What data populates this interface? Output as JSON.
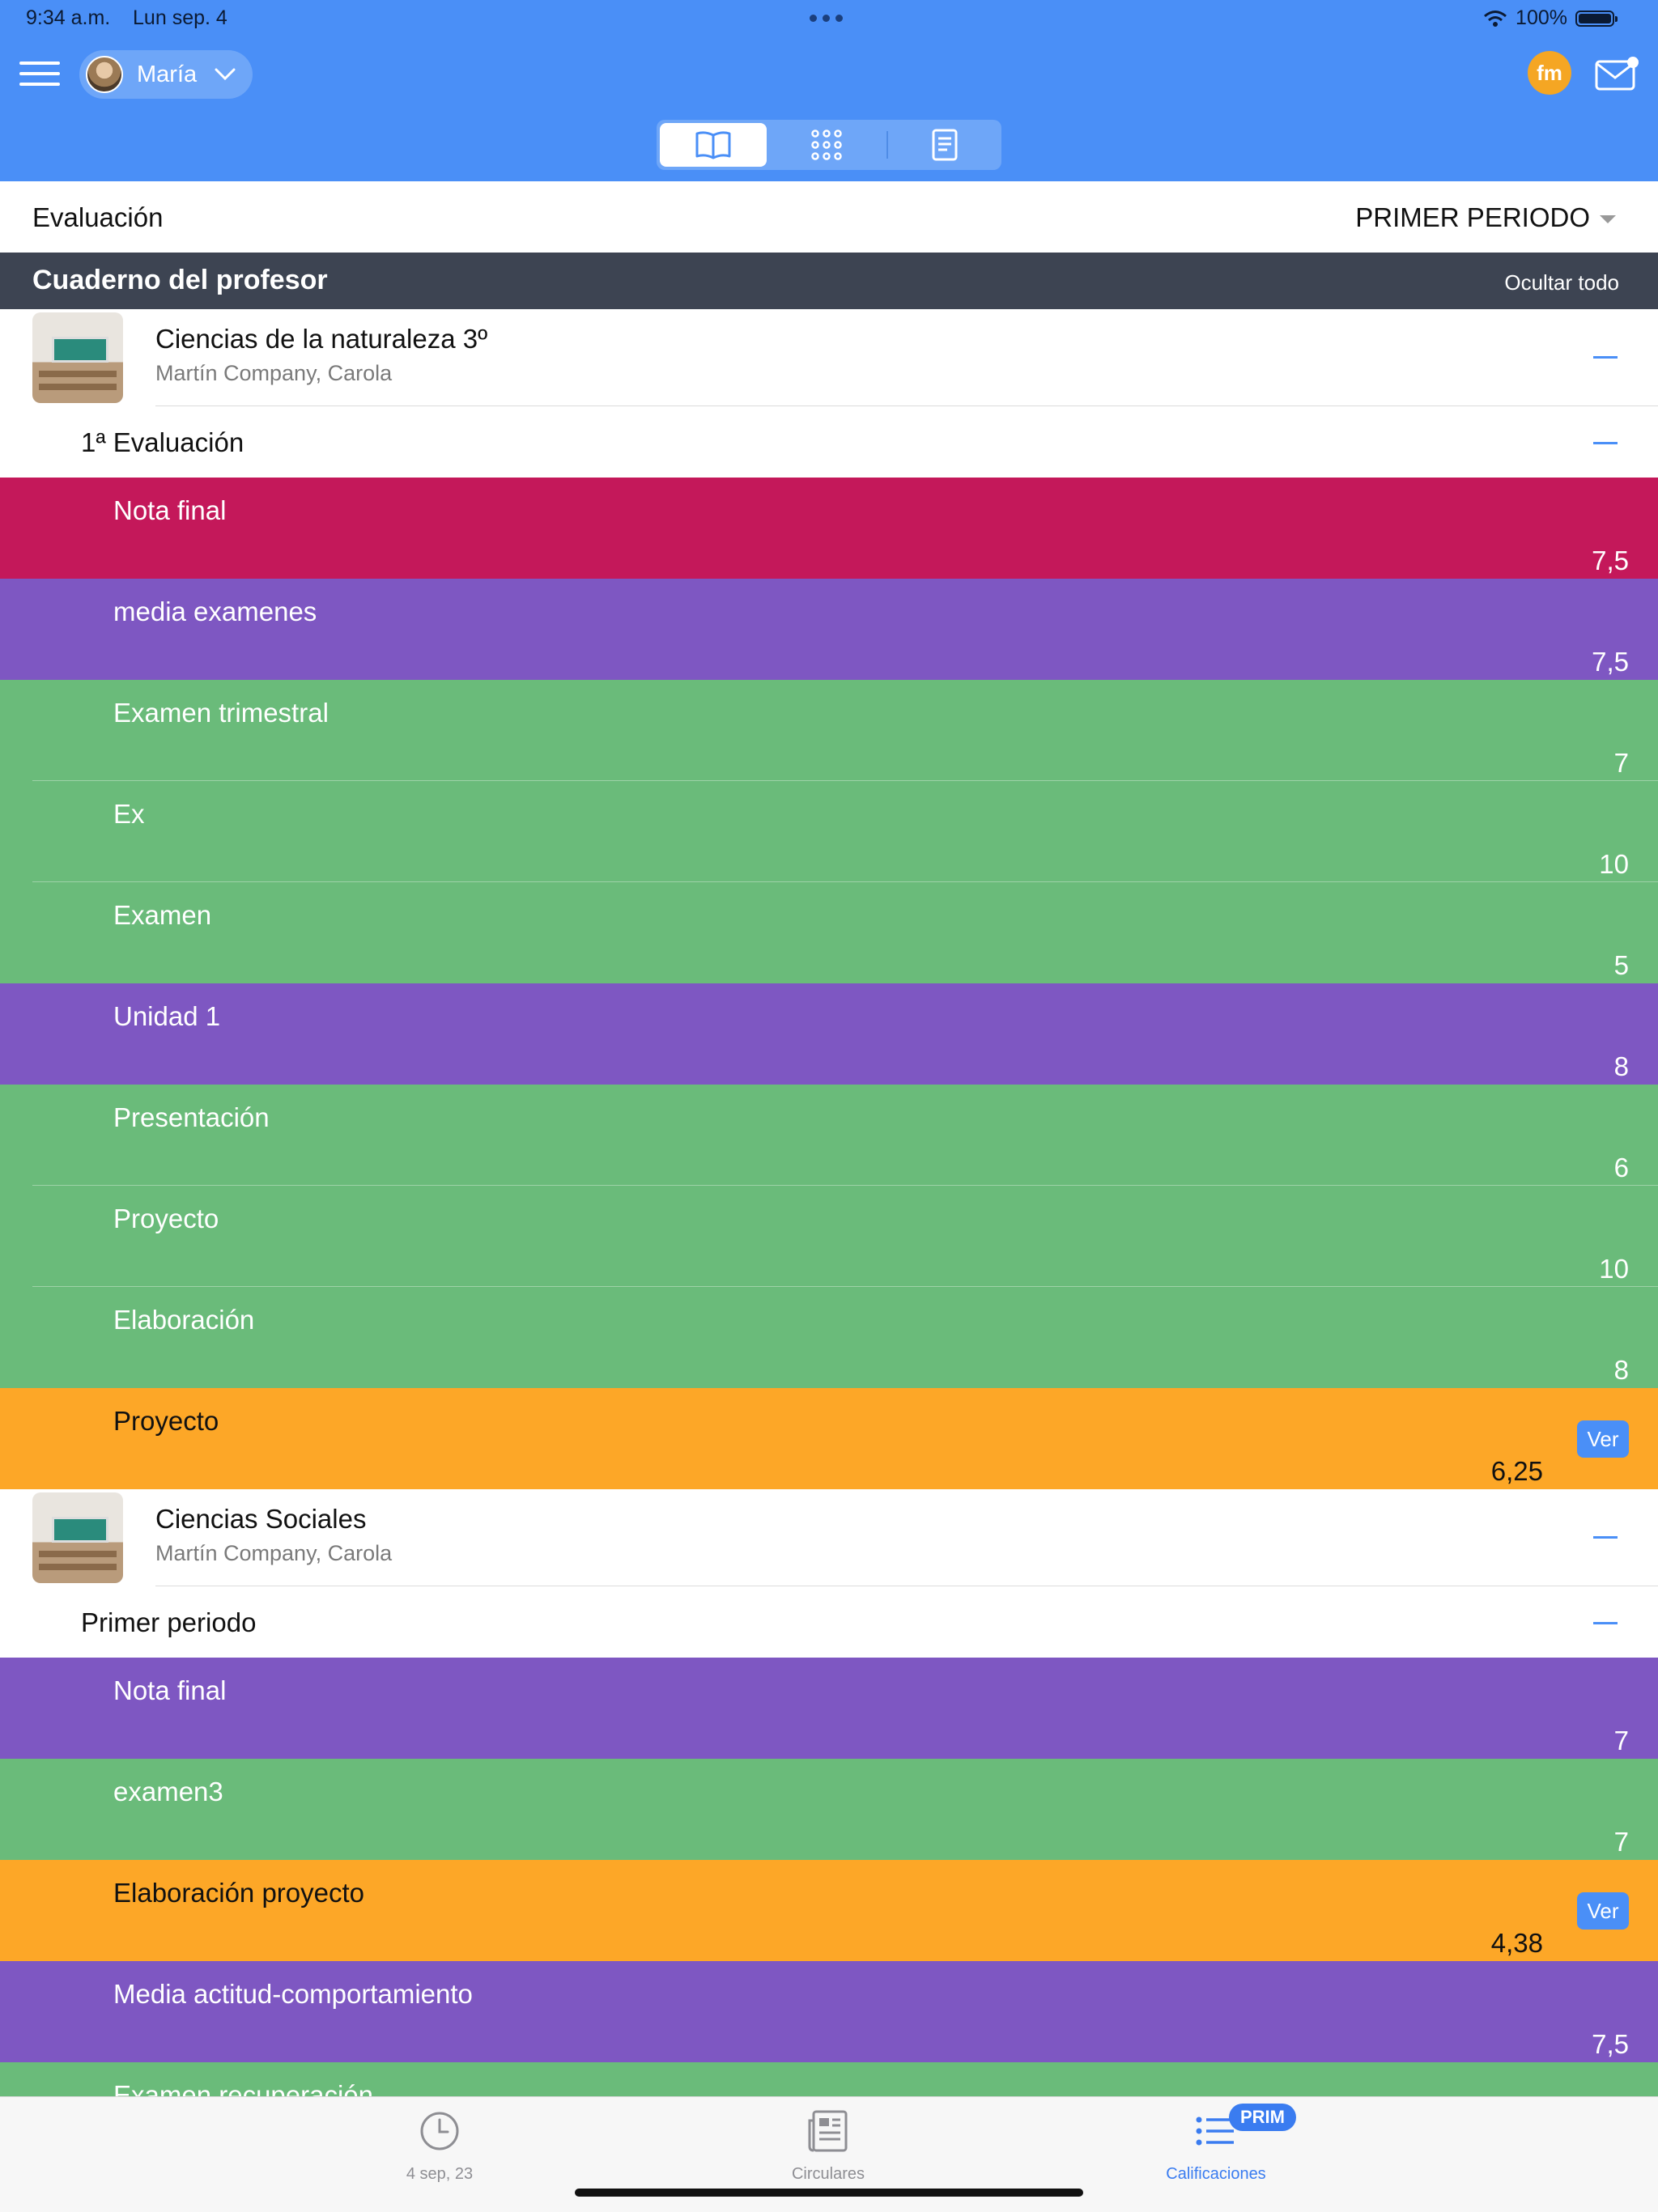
{
  "status_bar": {
    "time": "9:34 a.m.",
    "date": "Lun sep. 4",
    "battery": "100%"
  },
  "header": {
    "user_name": "María",
    "fm_badge": "fm"
  },
  "evaluation_bar": {
    "label": "Evaluación",
    "period": "PRIMER PERIODO"
  },
  "section_bar": {
    "title": "Cuaderno del profesor",
    "action": "Ocultar todo"
  },
  "subjects": [
    {
      "title": "Ciencias de la naturaleza 3º",
      "teacher": "Martín Company, Carola",
      "evaluation": "1ª Evaluación",
      "rows": [
        {
          "label": "Nota final",
          "value": "7,5",
          "color": "#c4185a"
        },
        {
          "label": "media examenes",
          "value": "7,5",
          "color": "#7e57c2"
        },
        {
          "label": "Examen trimestral",
          "value": "7",
          "color": "#6abb7a"
        },
        {
          "label": "Ex",
          "value": "10",
          "color": "#6abb7a"
        },
        {
          "label": "Examen",
          "value": "5",
          "color": "#6abb7a"
        },
        {
          "label": "Unidad 1",
          "value": "8",
          "color": "#7e57c2"
        },
        {
          "label": "Presentación",
          "value": "6",
          "color": "#6abb7a"
        },
        {
          "label": "Proyecto",
          "value": "10",
          "color": "#6abb7a"
        },
        {
          "label": "Elaboración",
          "value": "8",
          "color": "#6abb7a"
        },
        {
          "label": "Proyecto",
          "value": "6,25",
          "color": "#fda727",
          "button": "Ver"
        }
      ]
    },
    {
      "title": "Ciencias Sociales",
      "teacher": "Martín Company, Carola",
      "evaluation": "Primer periodo",
      "rows": [
        {
          "label": "Nota final",
          "value": "7",
          "color": "#7e57c2"
        },
        {
          "label": "examen3",
          "value": "7",
          "color": "#6abb7a"
        },
        {
          "label": "Elaboración proyecto",
          "value": "4,38",
          "color": "#fda727",
          "button": "Ver"
        },
        {
          "label": "Media actitud-comportamiento",
          "value": "7,5",
          "color": "#7e57c2"
        },
        {
          "label": "Examen recuperación",
          "value": "",
          "color": "#6abb7a"
        }
      ]
    }
  ],
  "tabbar": {
    "items": [
      {
        "label": "4 sep, 23",
        "icon": "clock-icon"
      },
      {
        "label": "Circulares",
        "icon": "newspaper-icon"
      },
      {
        "label": "Calificaciones",
        "icon": "list-icon",
        "badge": "PRIM"
      }
    ]
  }
}
